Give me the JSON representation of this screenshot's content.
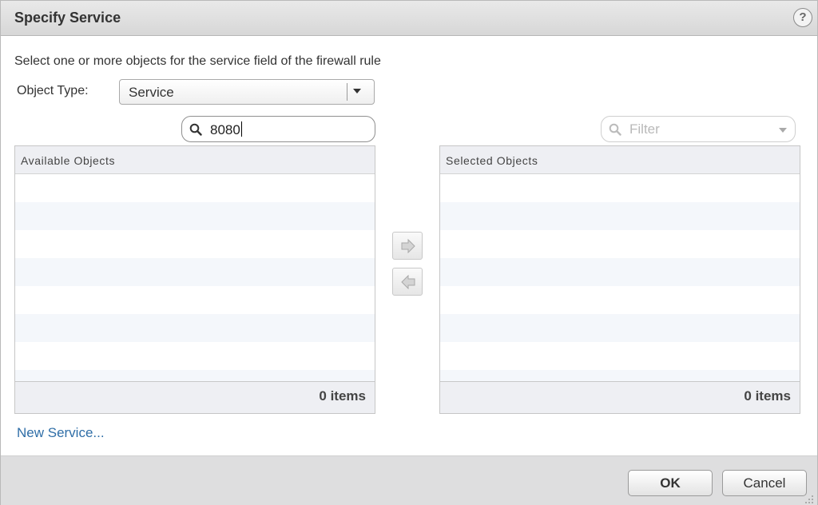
{
  "dialog": {
    "title": "Specify Service",
    "help_label": "?"
  },
  "instructions": "Select one or more objects for the service field of the firewall rule",
  "object_type": {
    "label": "Object Type:",
    "selected": "Service"
  },
  "search": {
    "value": "8080"
  },
  "filter": {
    "placeholder": "Filter"
  },
  "available": {
    "header": "Available Objects",
    "count": "0 items"
  },
  "selected": {
    "header": "Selected Objects",
    "count": "0 items"
  },
  "links": {
    "new_service": "New Service..."
  },
  "buttons": {
    "ok": "OK",
    "cancel": "Cancel"
  },
  "icons": {
    "help": "help-icon",
    "search": "search-icon",
    "filter": "search-icon",
    "add": "arrow-right-icon",
    "remove": "arrow-left-icon",
    "dropdown": "chevron-down-icon",
    "resize": "resize-grip-icon"
  },
  "colors": {
    "link": "#2f6ea7",
    "header_bg": "#eeeff3",
    "stripe": "#f4f7fb"
  }
}
